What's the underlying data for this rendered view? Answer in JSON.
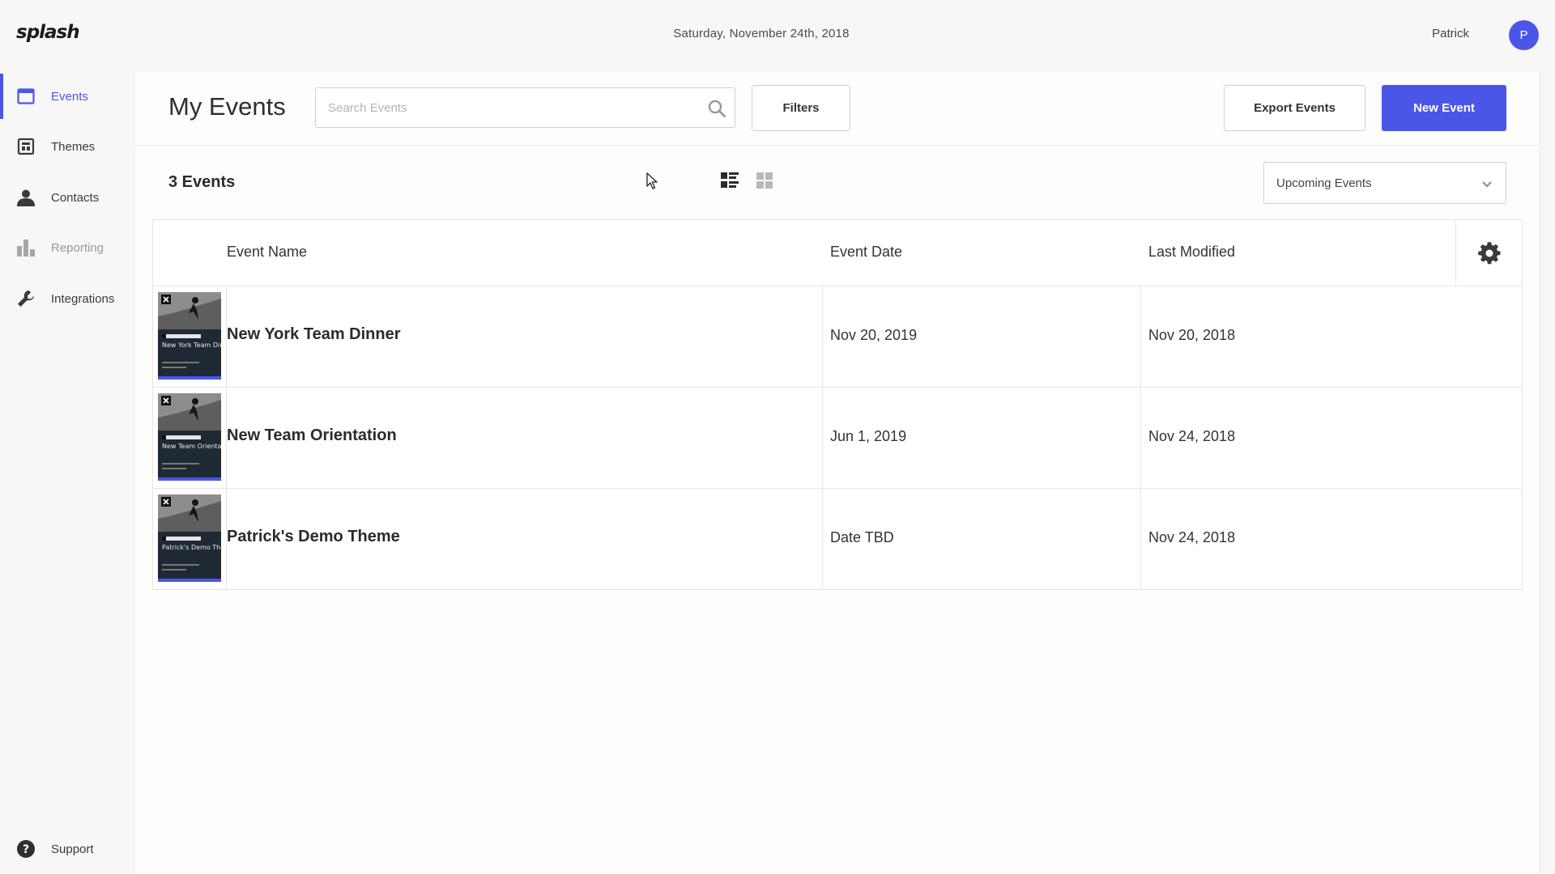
{
  "app": {
    "logo": "splash",
    "date": "Saturday, November 24th, 2018",
    "user_name": "Patrick",
    "avatar_initial": "P",
    "accent": "#4b56e8"
  },
  "sidebar": {
    "items": [
      {
        "label": "Events",
        "icon": "calendar-icon",
        "active": true
      },
      {
        "label": "Themes",
        "icon": "theme-icon"
      },
      {
        "label": "Contacts",
        "icon": "person-icon"
      },
      {
        "label": "Reporting",
        "icon": "bar-chart-icon",
        "muted": true
      },
      {
        "label": "Integrations",
        "icon": "wrench-icon"
      }
    ],
    "support_label": "Support"
  },
  "main": {
    "title": "My Events",
    "search": {
      "placeholder": "Search Events",
      "value": ""
    },
    "filters_label": "Filters",
    "export_label": "Export Events",
    "new_label": "New Event",
    "count_label": "3 Events",
    "filter_select": {
      "selected": "Upcoming Events"
    }
  },
  "table": {
    "columns": [
      "Event Name",
      "Event Date",
      "Last Modified"
    ],
    "rows": [
      {
        "name": "New York Team Dinner",
        "date": "Nov 20, 2019",
        "modified": "Nov 20, 2018",
        "thumb_title": "New York Team Dinner"
      },
      {
        "name": "New Team Orientation",
        "date": "Jun 1, 2019",
        "modified": "Nov 24, 2018",
        "thumb_title": "New Team Orientation"
      },
      {
        "name": "Patrick's Demo Theme",
        "date": "Date TBD",
        "modified": "Nov 24, 2018",
        "thumb_title": "Patrick's Demo Theme"
      }
    ]
  }
}
